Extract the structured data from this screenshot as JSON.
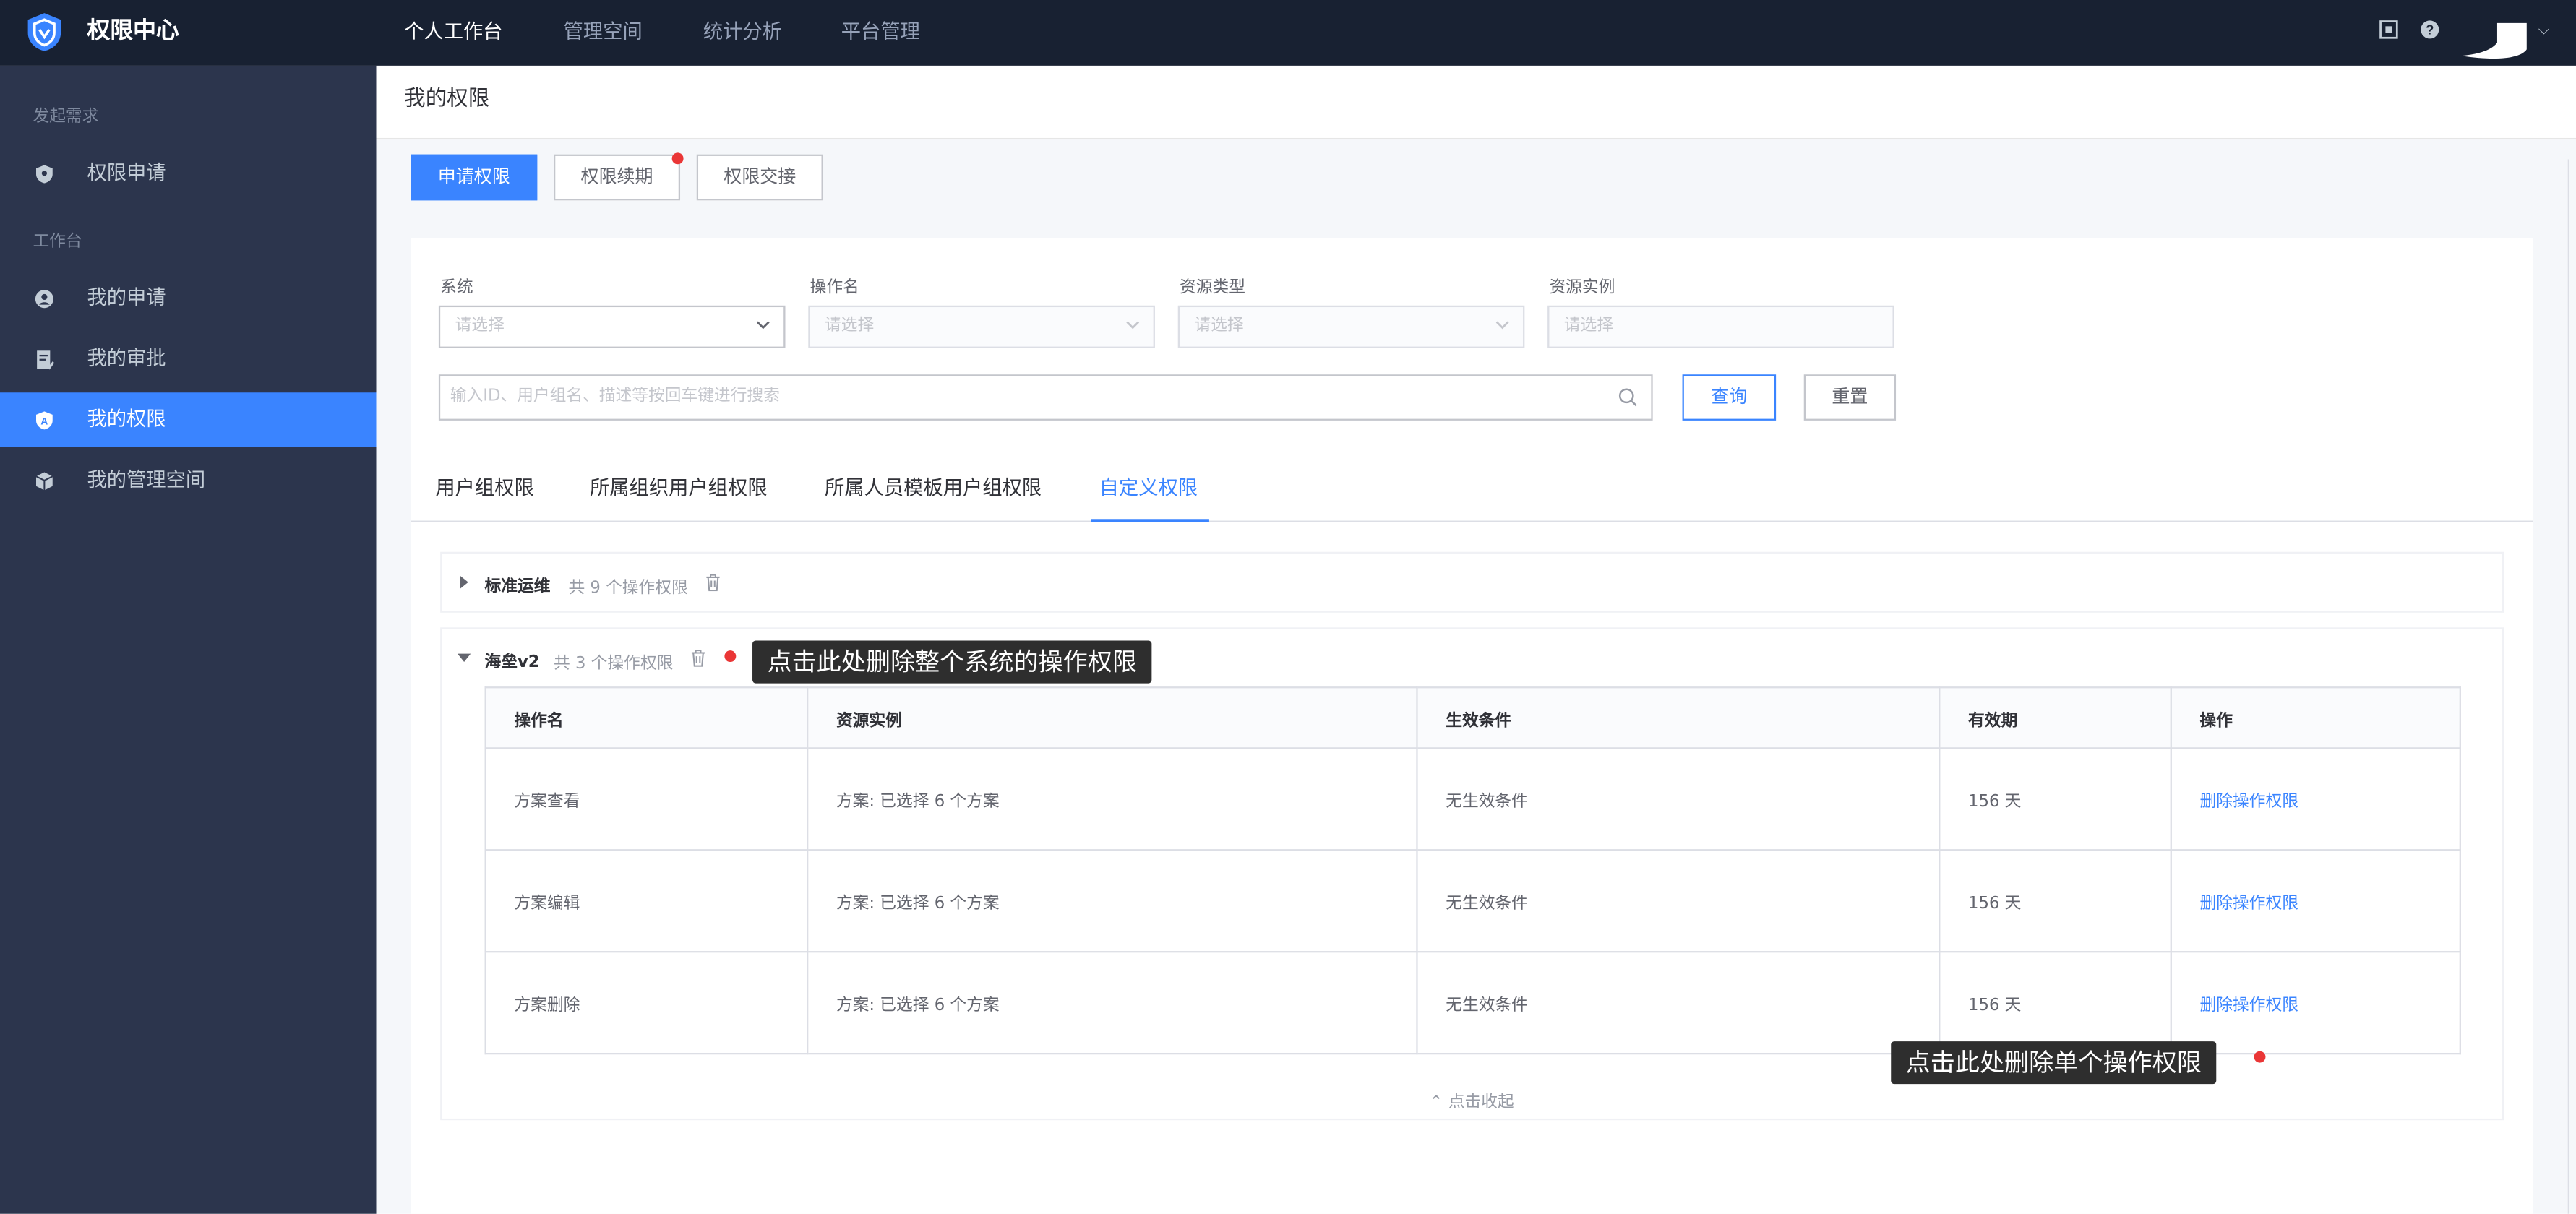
{
  "app": {
    "brand": "权限中心"
  },
  "topnav": {
    "items": [
      {
        "label": "个人工作台",
        "active": true
      },
      {
        "label": "管理空间",
        "active": false
      },
      {
        "label": "统计分析",
        "active": false
      },
      {
        "label": "平台管理",
        "active": false
      }
    ],
    "icons": [
      "screen-icon",
      "help-icon",
      "avatar",
      "chevron-down-icon"
    ]
  },
  "sidebar": {
    "group1": "发起需求",
    "group2": "工作台",
    "items": [
      {
        "label": "权限申请",
        "icon": "apply-shield-icon"
      },
      {
        "label": "我的申请",
        "icon": "user-circle-icon"
      },
      {
        "label": "我的审批",
        "icon": "approval-doc-icon"
      },
      {
        "label": "我的权限",
        "icon": "shield-icon",
        "active": true
      },
      {
        "label": "我的管理空间",
        "icon": "cube-icon"
      }
    ]
  },
  "page": {
    "title": "我的权限"
  },
  "actions": {
    "apply": "申请权限",
    "renew": "权限续期",
    "handover": "权限交接"
  },
  "filters": {
    "system_label": "系统",
    "action_label": "操作名",
    "resource_type_label": "资源类型",
    "resource_instance_label": "资源实例",
    "select_placeholder": "请选择",
    "search_placeholder": "输入ID、用户组名、描述等按回车键进行搜索",
    "query": "查询",
    "reset": "重置"
  },
  "tabs": [
    {
      "label": "用户组权限",
      "active": false
    },
    {
      "label": "所属组织用户组权限",
      "active": false
    },
    {
      "label": "所属人员模板用户组权限",
      "active": false
    },
    {
      "label": "自定义权限",
      "active": true
    }
  ],
  "systems": [
    {
      "name": "标准运维",
      "count": "共 9 个操作权限",
      "expanded": false
    },
    {
      "name": "海垒v2",
      "count": "共 3 个操作权限",
      "expanded": true
    }
  ],
  "tooltips": {
    "delete_system": "点击此处删除整个系统的操作权限",
    "delete_single": "点击此处删除单个操作权限"
  },
  "table": {
    "headers": [
      "操作名",
      "资源实例",
      "生效条件",
      "有效期",
      "操作"
    ],
    "rows": [
      {
        "name": "方案查看",
        "instance": "方案: 已选择 6 个方案",
        "condition": "无生效条件",
        "expiry": "156 天",
        "action": "删除操作权限"
      },
      {
        "name": "方案编辑",
        "instance": "方案: 已选择 6 个方案",
        "condition": "无生效条件",
        "expiry": "156 天",
        "action": "删除操作权限"
      },
      {
        "name": "方案删除",
        "instance": "方案: 已选择 6 个方案",
        "condition": "无生效条件",
        "expiry": "156 天",
        "action": "删除操作权限"
      }
    ],
    "collapse": "点击收起"
  },
  "colors": {
    "primary": "#3a84ff",
    "nav_bg": "#182132",
    "sidebar_bg": "#2c354d",
    "danger": "#ea3636"
  }
}
